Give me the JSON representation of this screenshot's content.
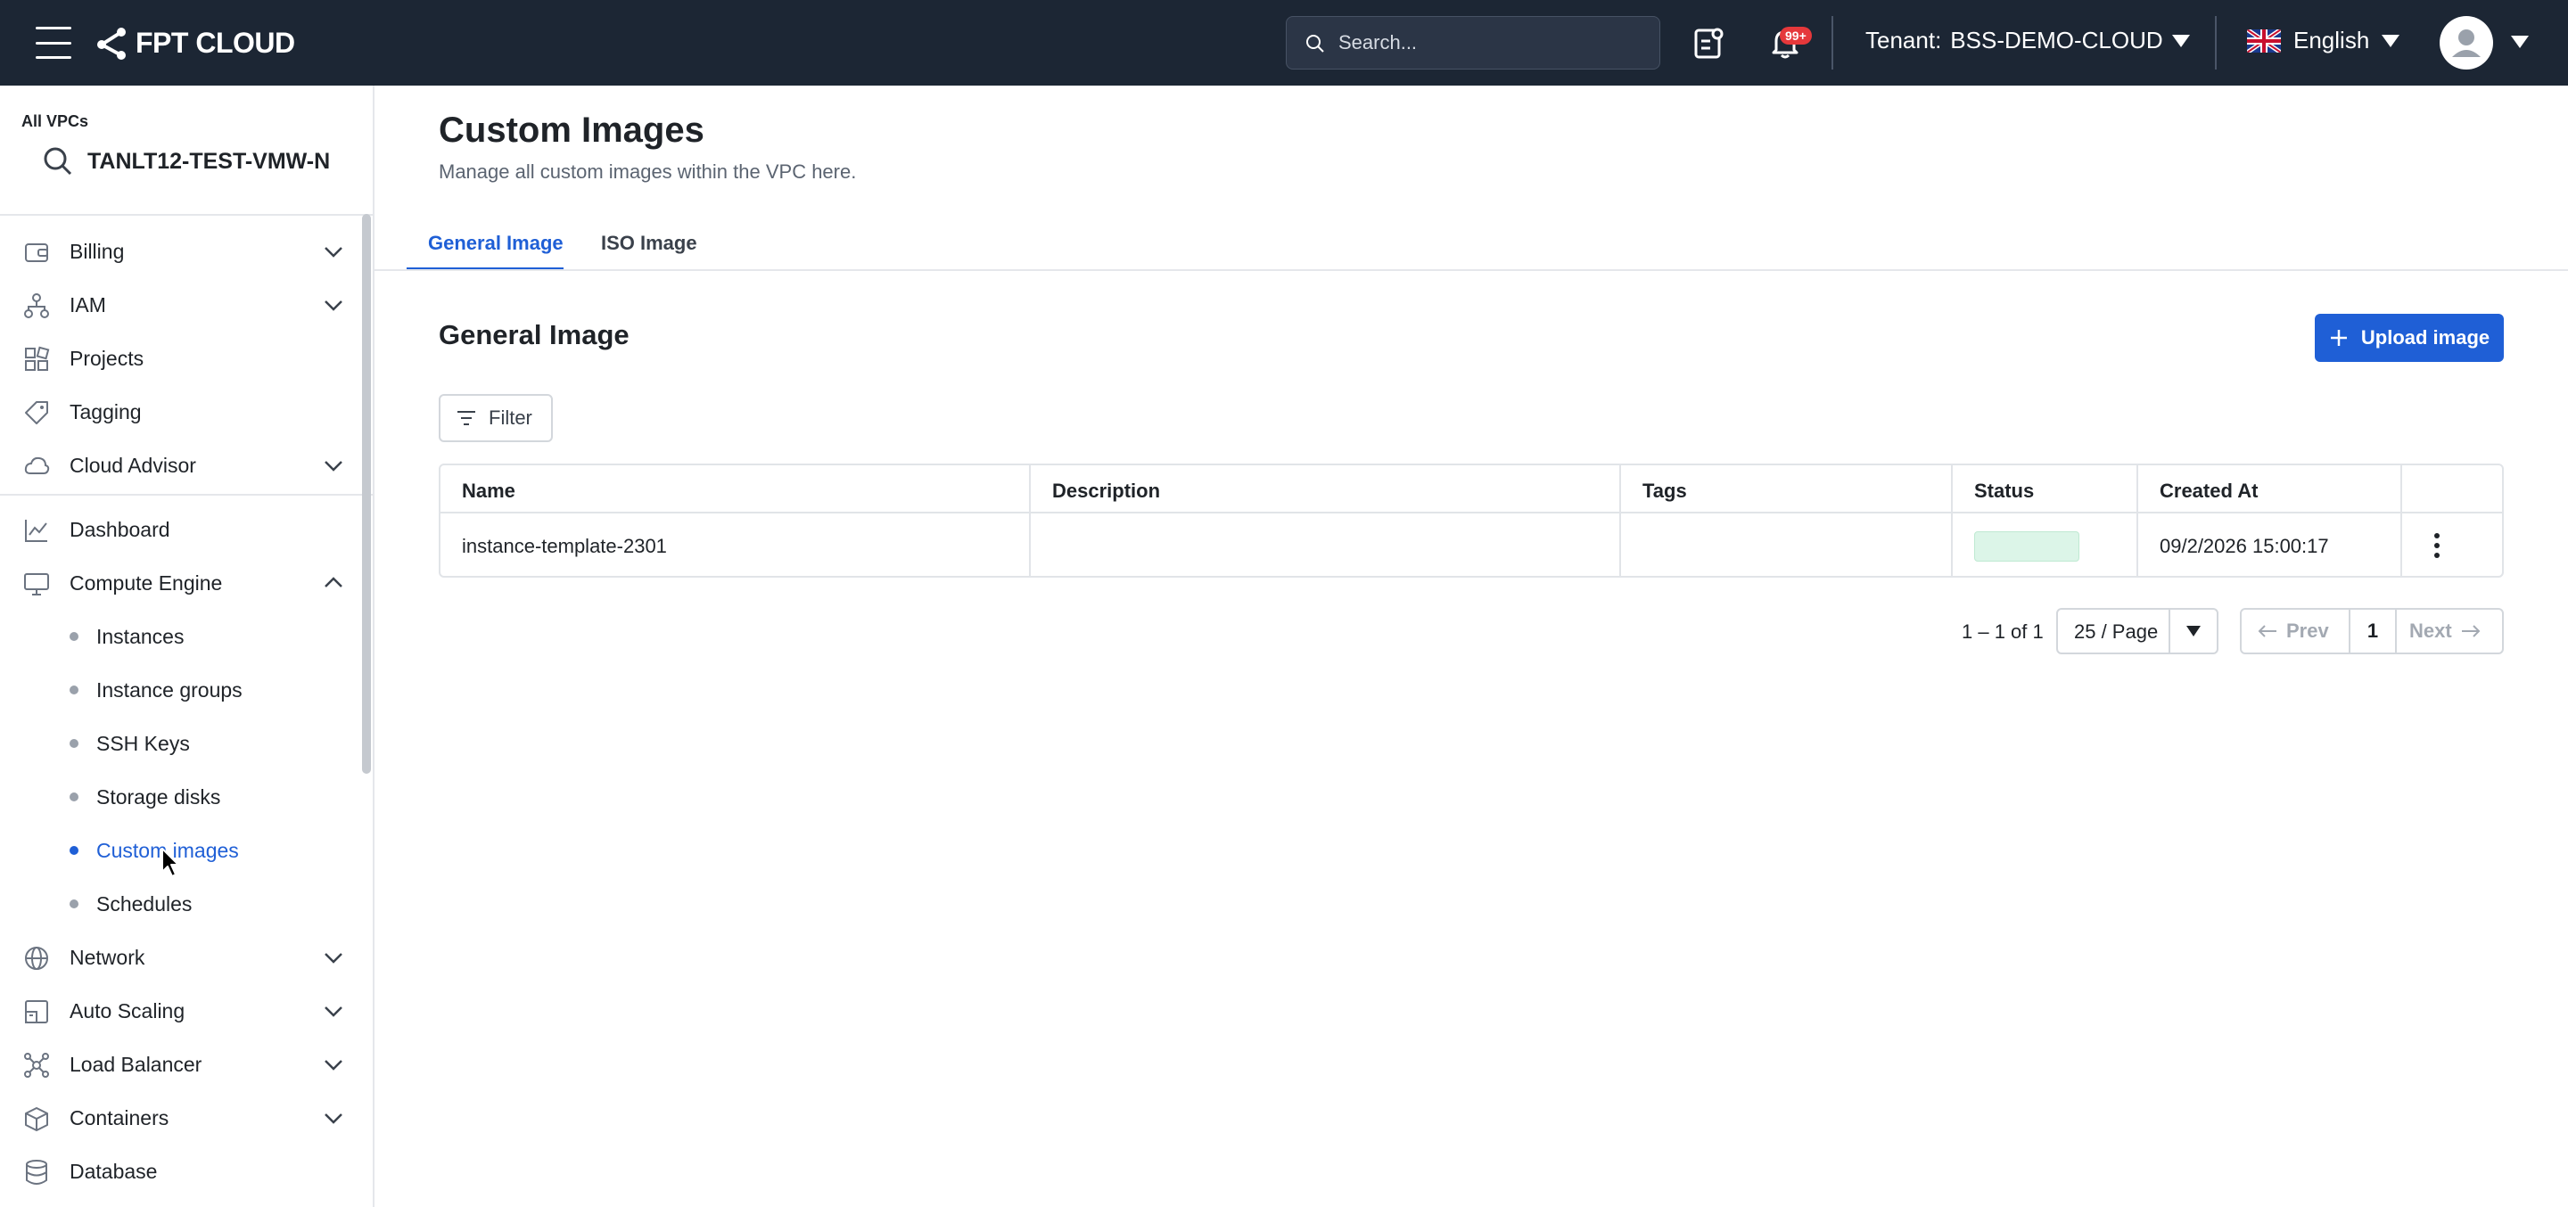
{
  "topbar": {
    "logo_text": "FPT CLOUD",
    "search_placeholder": "Search...",
    "notification_badge": "99+",
    "tenant_label": "Tenant:",
    "tenant_value": "BSS-DEMO-CLOUD",
    "language": "English"
  },
  "sidebar": {
    "vpc_label": "All VPCs",
    "vpc_value": "TANLT12-TEST-VMW-N",
    "items": [
      {
        "label": "Billing",
        "icon": "wallet-icon"
      },
      {
        "label": "IAM",
        "icon": "hierarchy-icon"
      },
      {
        "label": "Projects",
        "icon": "blocks-icon"
      },
      {
        "label": "Tagging",
        "icon": "tag-icon"
      },
      {
        "label": "Cloud Advisor",
        "icon": "cloud-icon"
      }
    ],
    "items2": [
      {
        "label": "Dashboard",
        "icon": "chart-icon"
      },
      {
        "label": "Compute Engine",
        "icon": "monitor-icon"
      }
    ],
    "compute_sub": [
      {
        "label": "Instances"
      },
      {
        "label": "Instance groups"
      },
      {
        "label": "SSH Keys"
      },
      {
        "label": "Storage disks"
      },
      {
        "label": "Custom images"
      },
      {
        "label": "Schedules"
      }
    ],
    "items3": [
      {
        "label": "Network",
        "icon": "globe-icon"
      },
      {
        "label": "Auto Scaling",
        "icon": "scaling-icon"
      },
      {
        "label": "Load Balancer",
        "icon": "network-icon"
      },
      {
        "label": "Containers",
        "icon": "box-icon"
      },
      {
        "label": "Database",
        "icon": "database-icon"
      }
    ]
  },
  "main": {
    "title": "Custom Images",
    "subtitle": "Manage all custom images within the VPC here.",
    "tabs": [
      {
        "label": "General Image",
        "active": true
      },
      {
        "label": "ISO Image",
        "active": false
      }
    ],
    "section_title": "General Image",
    "upload_label": "Upload image",
    "filter_label": "Filter",
    "table": {
      "columns": [
        "Name",
        "Description",
        "Tags",
        "Status",
        "Created At"
      ],
      "rows": [
        {
          "name": "instance-template-2301",
          "description": "",
          "tags": "",
          "status_color": "#dcf5e8",
          "created_at": "09/2/2026 15:00:17"
        }
      ]
    },
    "pagination": {
      "range": "1 – 1 of 1",
      "page_size": "25 / Page",
      "prev": "Prev",
      "page": "1",
      "next": "Next"
    }
  },
  "colors": {
    "accent": "#1f5fd6",
    "topbar_bg": "#1c2634"
  }
}
